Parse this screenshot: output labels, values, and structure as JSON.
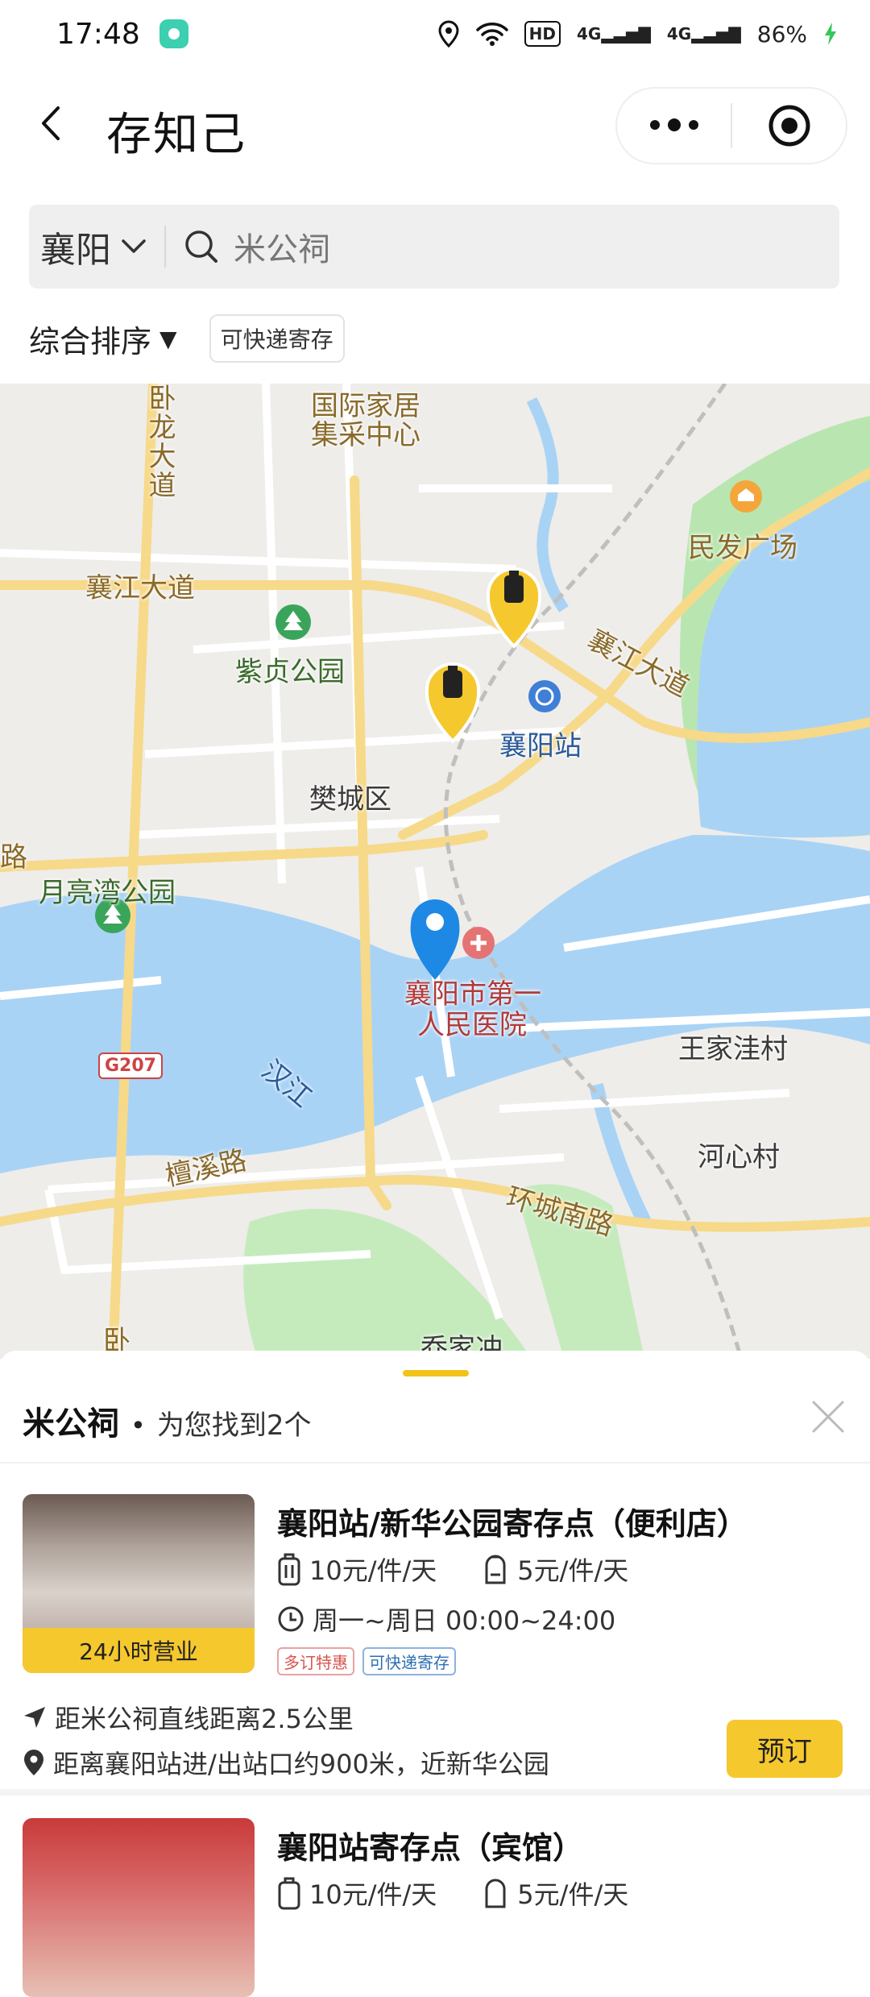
{
  "status": {
    "time": "17:48",
    "hd": "HD",
    "signal1": "4G",
    "signal2": "4G",
    "battery": "86%"
  },
  "nav": {
    "title": "存知己"
  },
  "search": {
    "city": "襄阳",
    "query": "米公祠"
  },
  "filters": {
    "sort": "综合排序",
    "sort_arrow": "▼",
    "chip": "可快递寄存"
  },
  "map": {
    "labels": {
      "wolong_road": "卧龙大道",
      "intl_home": "国际家居",
      "intl_home2": "集采中心",
      "minfa": "民发广场",
      "xiangjiang_road_left": "襄江大道",
      "xiangjiang_road_right": "襄江大道",
      "zizhen_park": "紫贞公园",
      "xiangyang_station": "襄阳站",
      "fancheng": "樊城区",
      "lu": "路",
      "yueliangwan": "月亮湾公园",
      "hospital1": "襄阳市第一",
      "hospital2": "人民医院",
      "wangjiawa": "王家洼村",
      "g207": "G207",
      "hanjiang": "汉江",
      "tanxi": "檀溪路",
      "hexin": "河心村",
      "huancheng": "环城南路",
      "qiaojia": "乔家冲",
      "wo_bottom": "卧"
    },
    "colors": {
      "water": "#a9d3f5",
      "green": "#b9e6b0",
      "road": "#f7d98a",
      "pin_blue": "#1e88e5",
      "marker_yellow": "#f5c82e"
    }
  },
  "sheet": {
    "keyword": "米公祠",
    "dot": "•",
    "found": "为您找到2个"
  },
  "results": [
    {
      "name": "襄阳站/新华公园寄存点（便利店）",
      "tag": "24小时营业",
      "price_bag": "10元/件/天",
      "price_pack": "5元/件/天",
      "hours": "周一~周日 00:00~24:00",
      "badge1": "多订特惠",
      "badge2": "可快递寄存",
      "distance": "距米公祠直线距离2.5公里",
      "near": "距离襄阳站进/出站口约900米，近新华公园",
      "book": "预订"
    },
    {
      "name": "襄阳站寄存点（宾馆）",
      "price_bag": "10元/件/天",
      "price_pack": "5元/件/天"
    }
  ]
}
